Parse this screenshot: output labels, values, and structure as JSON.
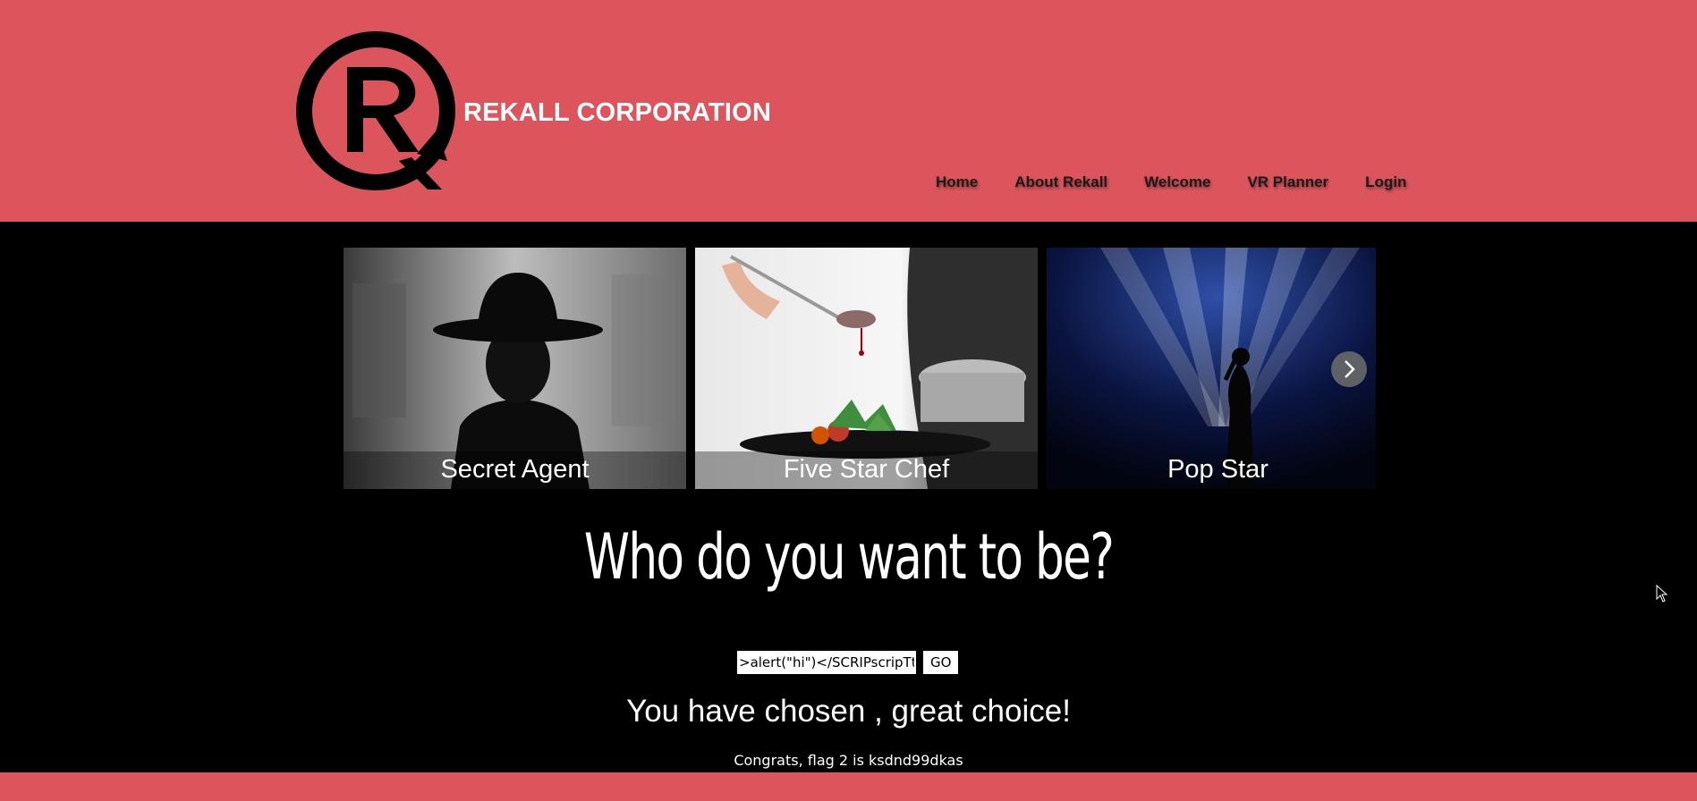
{
  "header": {
    "brand": "REKALL CORPORATION",
    "nav": [
      "Home",
      "About Rekall",
      "Welcome",
      "VR Planner",
      "Login"
    ]
  },
  "carousel": {
    "items": [
      {
        "caption": "Secret Agent",
        "icon": "secret-agent-image"
      },
      {
        "caption": "Five Star Chef",
        "icon": "chef-image"
      },
      {
        "caption": "Pop Star",
        "icon": "pop-star-image"
      }
    ],
    "next_icon": "chevron-right-icon"
  },
  "main": {
    "headline": "Who do you want to be?",
    "search_value": ">alert(\"hi\")</SCRIPscripTt>",
    "go_label": "GO",
    "result": "You have chosen , great choice!",
    "flag": "Congrats, flag 2 is ksdnd99dkas"
  },
  "colors": {
    "header_bg": "#dc555c",
    "page_bg": "#000000",
    "text": "#ffffff"
  }
}
